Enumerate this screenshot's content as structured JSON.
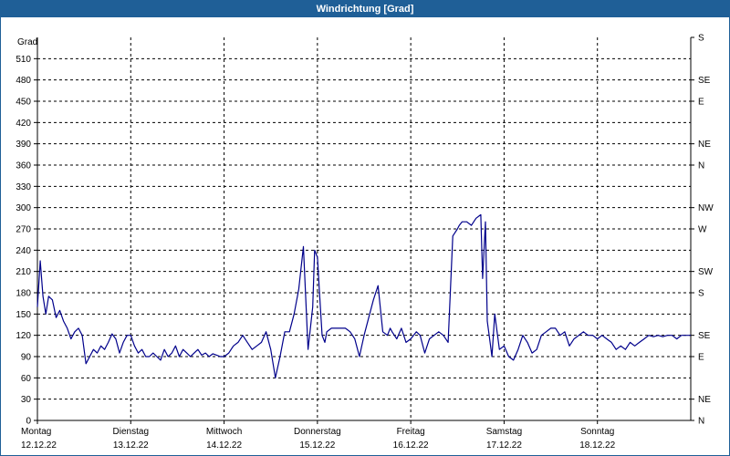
{
  "window": {
    "title": "Windrichtung [Grad]"
  },
  "chart_data": {
    "type": "line",
    "title": "Windrichtung [Grad]",
    "ylabel": "Grad",
    "ylim": [
      0,
      540
    ],
    "y_ticks": [
      0,
      30,
      60,
      90,
      120,
      150,
      180,
      210,
      240,
      270,
      300,
      330,
      360,
      390,
      420,
      450,
      480,
      510
    ],
    "y2_ticks": [
      "N",
      "NE",
      "E",
      "SE",
      "S",
      "SW",
      "W",
      "NW",
      "N",
      "NE",
      "E",
      "SE",
      "S"
    ],
    "y2_tick_values": [
      0,
      30,
      90,
      120,
      180,
      210,
      270,
      300,
      360,
      390,
      450,
      480,
      540
    ],
    "xlim": [
      0,
      7
    ],
    "x_ticks": [
      {
        "day": "Montag",
        "date": "12.12.22"
      },
      {
        "day": "Dienstag",
        "date": "13.12.22"
      },
      {
        "day": "Mittwoch",
        "date": "14.12.22"
      },
      {
        "day": "Donnerstag",
        "date": "15.12.22"
      },
      {
        "day": "Freitag",
        "date": "16.12.22"
      },
      {
        "day": "Samstag",
        "date": "17.12.22"
      },
      {
        "day": "Sonntag",
        "date": "18.12.22"
      }
    ],
    "grid": true,
    "color": "#00008b",
    "series": [
      {
        "x": [
          0,
          0.03,
          0.06,
          0.09,
          0.12,
          0.16,
          0.2,
          0.24,
          0.28,
          0.32,
          0.36,
          0.4,
          0.44,
          0.48,
          0.52,
          0.56,
          0.6,
          0.64,
          0.68,
          0.72,
          0.76,
          0.8,
          0.84,
          0.88,
          0.92,
          0.96,
          1.0,
          1.04,
          1.08,
          1.12,
          1.16,
          1.2,
          1.24,
          1.28,
          1.32,
          1.36,
          1.4,
          1.44,
          1.48,
          1.52,
          1.56,
          1.6,
          1.64,
          1.68,
          1.72,
          1.76,
          1.8,
          1.84,
          1.88,
          1.92,
          1.96,
          2.0,
          2.05,
          2.1,
          2.15,
          2.2,
          2.25,
          2.3,
          2.35,
          2.4,
          2.45,
          2.5,
          2.55,
          2.6,
          2.65,
          2.7,
          2.75,
          2.8,
          2.85,
          2.9,
          2.95,
          2.97,
          3.0,
          3.02,
          3.05,
          3.08,
          3.1,
          3.15,
          3.2,
          3.25,
          3.3,
          3.35,
          3.4,
          3.45,
          3.5,
          3.55,
          3.6,
          3.65,
          3.7,
          3.75,
          3.78,
          3.8,
          3.85,
          3.9,
          3.95,
          4.0,
          4.03,
          4.06,
          4.1,
          4.15,
          4.2,
          4.25,
          4.3,
          4.35,
          4.4,
          4.45,
          4.5,
          4.52,
          4.55,
          4.6,
          4.65,
          4.7,
          4.75,
          4.77,
          4.8,
          4.82,
          4.85,
          4.87,
          4.9,
          4.95,
          5.0,
          5.05,
          5.1,
          5.15,
          5.2,
          5.25,
          5.3,
          5.35,
          5.4,
          5.45,
          5.5,
          5.55,
          5.6,
          5.65,
          5.7,
          5.75,
          5.8,
          5.85,
          5.9,
          5.95,
          6.0,
          6.05,
          6.1,
          6.15,
          6.2,
          6.25,
          6.3,
          6.35,
          6.4,
          6.45,
          6.5,
          6.55,
          6.6,
          6.65,
          6.7,
          6.75,
          6.8,
          6.85,
          6.9,
          6.95,
          7.0
        ],
        "y": [
          160,
          225,
          175,
          150,
          175,
          170,
          145,
          155,
          140,
          130,
          115,
          125,
          130,
          120,
          80,
          90,
          100,
          95,
          105,
          100,
          110,
          122,
          115,
          95,
          110,
          120,
          120,
          105,
          95,
          100,
          90,
          90,
          95,
          90,
          85,
          100,
          90,
          95,
          105,
          90,
          100,
          95,
          90,
          95,
          100,
          92,
          95,
          90,
          94,
          92,
          90,
          90,
          95,
          105,
          110,
          120,
          110,
          100,
          105,
          110,
          125,
          100,
          60,
          90,
          125,
          125,
          150,
          185,
          245,
          100,
          160,
          240,
          230,
          185,
          120,
          110,
          125,
          130,
          130,
          130,
          130,
          125,
          115,
          90,
          120,
          145,
          170,
          190,
          125,
          120,
          130,
          125,
          115,
          130,
          110,
          115,
          120,
          125,
          120,
          95,
          115,
          120,
          125,
          120,
          110,
          260,
          270,
          275,
          280,
          280,
          275,
          285,
          290,
          200,
          280,
          140,
          110,
          90,
          150,
          100,
          105,
          90,
          85,
          100,
          120,
          110,
          95,
          100,
          120,
          125,
          130,
          130,
          120,
          125,
          105,
          115,
          120,
          125,
          120,
          120,
          115,
          120,
          115,
          110,
          100,
          105,
          100,
          110,
          105,
          110,
          115,
          120,
          118,
          120,
          118,
          120,
          120,
          115,
          120,
          120,
          120
        ]
      }
    ]
  }
}
